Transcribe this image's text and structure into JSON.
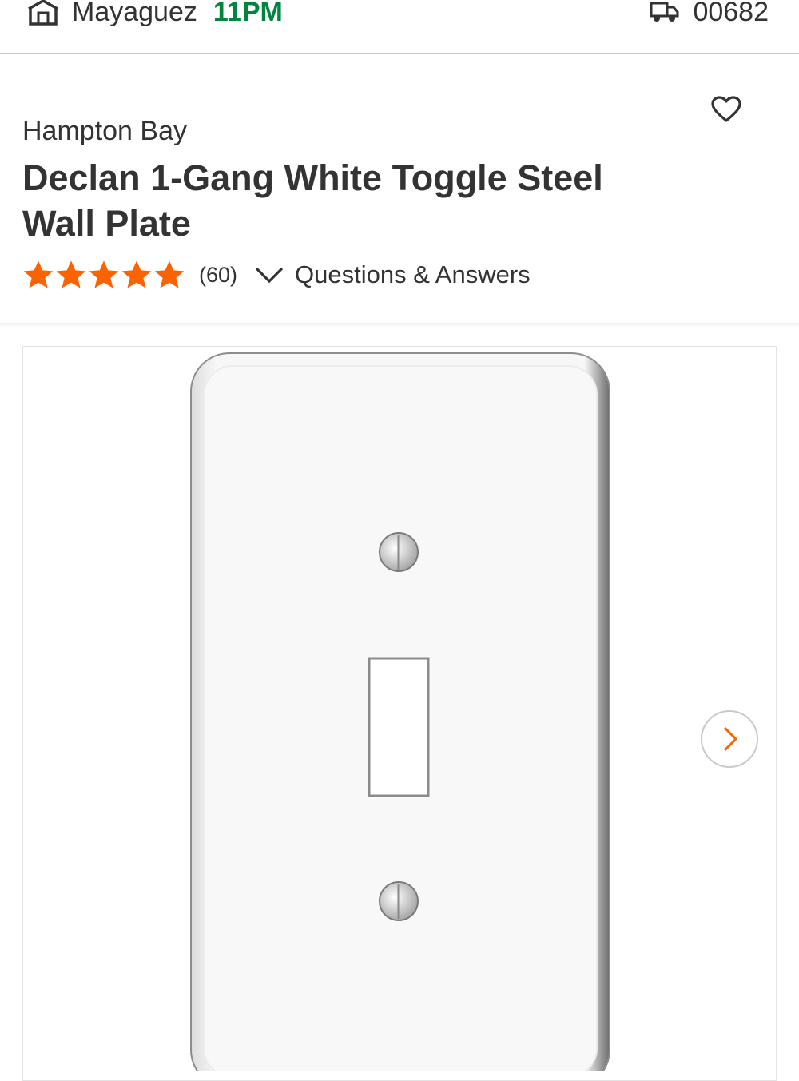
{
  "header": {
    "store_name": "Mayaguez",
    "store_hours": "11PM",
    "zip_code": "00682"
  },
  "product": {
    "brand": "Hampton Bay",
    "title": "Declan 1-Gang White Toggle Steel Wall Plate",
    "rating": 5,
    "rating_max": 5,
    "review_count": "(60)",
    "qa_label": "Questions & Answers"
  },
  "icons": {
    "store": "store-icon",
    "delivery": "truck-icon",
    "favorite": "heart-icon",
    "rating": "star-icon",
    "expand": "chevron-down-icon",
    "next": "chevron-right-icon"
  },
  "colors": {
    "store_hours": "#00853e",
    "star": "#f96302",
    "next_arrow": "#f96302",
    "text": "#333333"
  }
}
